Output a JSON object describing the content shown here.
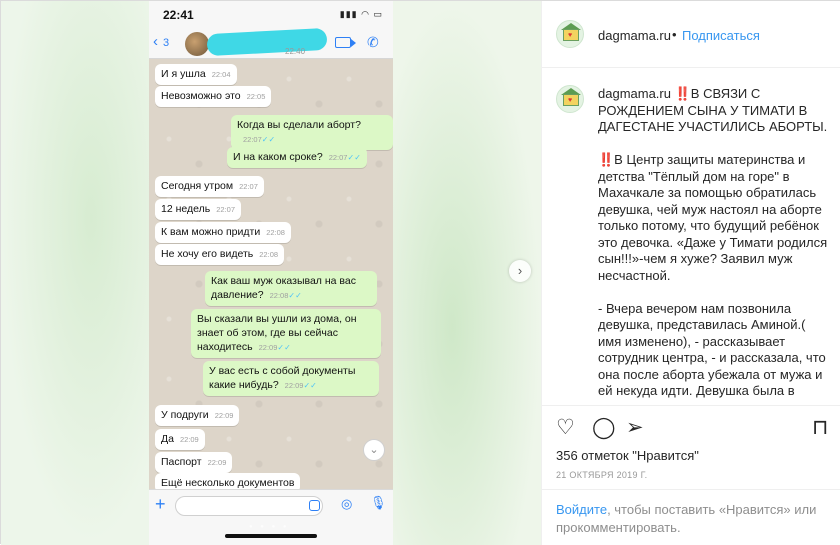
{
  "media": {
    "status_time": "22:41",
    "back_count": "3",
    "header_time": "22:40",
    "messages": [
      {
        "dir": "in",
        "text": "И я ушла",
        "time": "22:04"
      },
      {
        "dir": "in",
        "text": "Невозможно это",
        "time": "22:05"
      },
      {
        "dir": "out",
        "text": "Когда вы сделали аборт?",
        "time": "22:07"
      },
      {
        "dir": "out",
        "text": "И на каком сроке?",
        "time": "22:07"
      },
      {
        "dir": "in",
        "text": "Сегодня утром",
        "time": "22:07"
      },
      {
        "dir": "in",
        "text": "12 недель",
        "time": "22:07"
      },
      {
        "dir": "in",
        "text": "К вам можно придти",
        "time": "22:08"
      },
      {
        "dir": "in",
        "text": "Не хочу его видеть",
        "time": "22:08"
      },
      {
        "dir": "out",
        "text": "Как ваш муж оказывал на вас давление?",
        "time": "22:08"
      },
      {
        "dir": "out",
        "text": "Вы сказали вы ушли из дома, он знает об этом, где вы сейчас находитесь",
        "time": "22:09"
      },
      {
        "dir": "out",
        "text": "У вас есть с собой документы какие нибудь?",
        "time": "22:09"
      },
      {
        "dir": "in",
        "text": "У подруги",
        "time": "22:09"
      },
      {
        "dir": "in",
        "text": "Да",
        "time": "22:09"
      },
      {
        "dir": "in",
        "text": "Паспорт",
        "time": "22:09"
      },
      {
        "dir": "in",
        "text": "Ещё несколько документов",
        "time": ""
      }
    ]
  },
  "header": {
    "username": "dagmama.ru",
    "separator": "•",
    "follow_label": "Подписаться"
  },
  "caption": {
    "username": "dagmama.ru",
    "text": " ‼️В СВЯЗИ С РОЖДЕНИЕМ СЫНА У ТИМАТИ В ДАГЕСТАНЕ УЧАСТИЛИСЬ АБОРТЫ.\n\n‼️В Центр защиты материнства и детства \"Тёплый дом на горе\" в Махачкале за помощью обратилась девушка, чей муж настоял на аборте только потому, что будущий ребёнок это девочка. «Даже у Тимати родился сын!!!»-чем я хуже? Заявил муж несчастной.\n\n- Вчера вечером нам позвонила девушка, представилась Аминой.( имя изменено), - рассказывает сотрудник центра, - и рассказала, что она после аборта убежала от мужа и ей некуда идти. Девушка была в положении и на плановом"
  },
  "actions": {
    "likes": "356 отметок \"Нравится\"",
    "date": "21 ОКТЯБРЯ 2019 Г."
  },
  "comment": {
    "login_link": "Войдите",
    "text": ", чтобы поставить «Нравится» или прокомментировать."
  },
  "colors": {
    "link_blue": "#3897f0",
    "whatsapp_out": "#dcf8c6",
    "redaction": "#3fd8e6"
  },
  "icons": [
    "heart-icon",
    "comment-icon",
    "share-icon",
    "bookmark-icon",
    "video-call-icon",
    "phone-call-icon",
    "camera-icon",
    "mic-icon",
    "chevron-right-icon"
  ]
}
